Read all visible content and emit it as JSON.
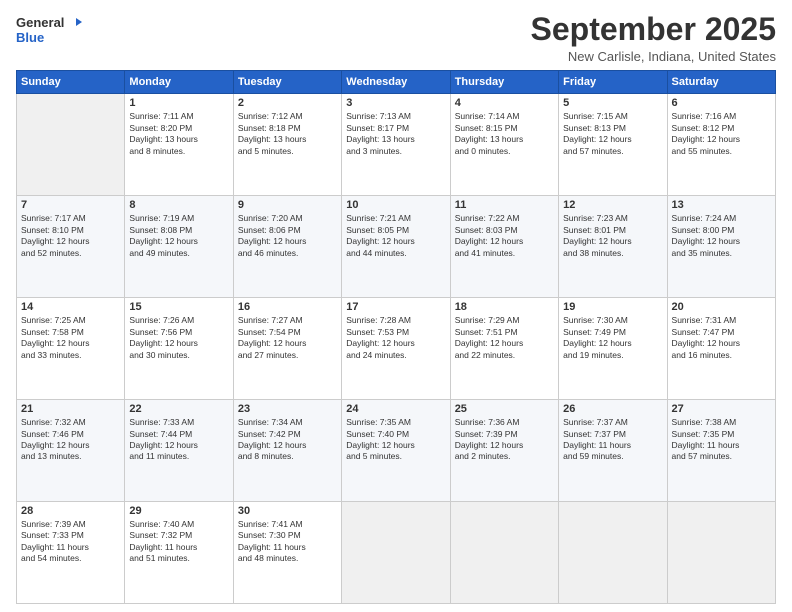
{
  "logo": {
    "line1": "General",
    "line2": "Blue"
  },
  "title": "September 2025",
  "subtitle": "New Carlisle, Indiana, United States",
  "days_of_week": [
    "Sunday",
    "Monday",
    "Tuesday",
    "Wednesday",
    "Thursday",
    "Friday",
    "Saturday"
  ],
  "weeks": [
    [
      {
        "day": "",
        "sunrise": "",
        "sunset": "",
        "daylight": ""
      },
      {
        "day": "1",
        "sunrise": "Sunrise: 7:11 AM",
        "sunset": "Sunset: 8:20 PM",
        "daylight": "Daylight: 13 hours and 8 minutes."
      },
      {
        "day": "2",
        "sunrise": "Sunrise: 7:12 AM",
        "sunset": "Sunset: 8:18 PM",
        "daylight": "Daylight: 13 hours and 5 minutes."
      },
      {
        "day": "3",
        "sunrise": "Sunrise: 7:13 AM",
        "sunset": "Sunset: 8:17 PM",
        "daylight": "Daylight: 13 hours and 3 minutes."
      },
      {
        "day": "4",
        "sunrise": "Sunrise: 7:14 AM",
        "sunset": "Sunset: 8:15 PM",
        "daylight": "Daylight: 13 hours and 0 minutes."
      },
      {
        "day": "5",
        "sunrise": "Sunrise: 7:15 AM",
        "sunset": "Sunset: 8:13 PM",
        "daylight": "Daylight: 12 hours and 57 minutes."
      },
      {
        "day": "6",
        "sunrise": "Sunrise: 7:16 AM",
        "sunset": "Sunset: 8:12 PM",
        "daylight": "Daylight: 12 hours and 55 minutes."
      }
    ],
    [
      {
        "day": "7",
        "sunrise": "Sunrise: 7:17 AM",
        "sunset": "Sunset: 8:10 PM",
        "daylight": "Daylight: 12 hours and 52 minutes."
      },
      {
        "day": "8",
        "sunrise": "Sunrise: 7:19 AM",
        "sunset": "Sunset: 8:08 PM",
        "daylight": "Daylight: 12 hours and 49 minutes."
      },
      {
        "day": "9",
        "sunrise": "Sunrise: 7:20 AM",
        "sunset": "Sunset: 8:06 PM",
        "daylight": "Daylight: 12 hours and 46 minutes."
      },
      {
        "day": "10",
        "sunrise": "Sunrise: 7:21 AM",
        "sunset": "Sunset: 8:05 PM",
        "daylight": "Daylight: 12 hours and 44 minutes."
      },
      {
        "day": "11",
        "sunrise": "Sunrise: 7:22 AM",
        "sunset": "Sunset: 8:03 PM",
        "daylight": "Daylight: 12 hours and 41 minutes."
      },
      {
        "day": "12",
        "sunrise": "Sunrise: 7:23 AM",
        "sunset": "Sunset: 8:01 PM",
        "daylight": "Daylight: 12 hours and 38 minutes."
      },
      {
        "day": "13",
        "sunrise": "Sunrise: 7:24 AM",
        "sunset": "Sunset: 8:00 PM",
        "daylight": "Daylight: 12 hours and 35 minutes."
      }
    ],
    [
      {
        "day": "14",
        "sunrise": "Sunrise: 7:25 AM",
        "sunset": "Sunset: 7:58 PM",
        "daylight": "Daylight: 12 hours and 33 minutes."
      },
      {
        "day": "15",
        "sunrise": "Sunrise: 7:26 AM",
        "sunset": "Sunset: 7:56 PM",
        "daylight": "Daylight: 12 hours and 30 minutes."
      },
      {
        "day": "16",
        "sunrise": "Sunrise: 7:27 AM",
        "sunset": "Sunset: 7:54 PM",
        "daylight": "Daylight: 12 hours and 27 minutes."
      },
      {
        "day": "17",
        "sunrise": "Sunrise: 7:28 AM",
        "sunset": "Sunset: 7:53 PM",
        "daylight": "Daylight: 12 hours and 24 minutes."
      },
      {
        "day": "18",
        "sunrise": "Sunrise: 7:29 AM",
        "sunset": "Sunset: 7:51 PM",
        "daylight": "Daylight: 12 hours and 22 minutes."
      },
      {
        "day": "19",
        "sunrise": "Sunrise: 7:30 AM",
        "sunset": "Sunset: 7:49 PM",
        "daylight": "Daylight: 12 hours and 19 minutes."
      },
      {
        "day": "20",
        "sunrise": "Sunrise: 7:31 AM",
        "sunset": "Sunset: 7:47 PM",
        "daylight": "Daylight: 12 hours and 16 minutes."
      }
    ],
    [
      {
        "day": "21",
        "sunrise": "Sunrise: 7:32 AM",
        "sunset": "Sunset: 7:46 PM",
        "daylight": "Daylight: 12 hours and 13 minutes."
      },
      {
        "day": "22",
        "sunrise": "Sunrise: 7:33 AM",
        "sunset": "Sunset: 7:44 PM",
        "daylight": "Daylight: 12 hours and 11 minutes."
      },
      {
        "day": "23",
        "sunrise": "Sunrise: 7:34 AM",
        "sunset": "Sunset: 7:42 PM",
        "daylight": "Daylight: 12 hours and 8 minutes."
      },
      {
        "day": "24",
        "sunrise": "Sunrise: 7:35 AM",
        "sunset": "Sunset: 7:40 PM",
        "daylight": "Daylight: 12 hours and 5 minutes."
      },
      {
        "day": "25",
        "sunrise": "Sunrise: 7:36 AM",
        "sunset": "Sunset: 7:39 PM",
        "daylight": "Daylight: 12 hours and 2 minutes."
      },
      {
        "day": "26",
        "sunrise": "Sunrise: 7:37 AM",
        "sunset": "Sunset: 7:37 PM",
        "daylight": "Daylight: 11 hours and 59 minutes."
      },
      {
        "day": "27",
        "sunrise": "Sunrise: 7:38 AM",
        "sunset": "Sunset: 7:35 PM",
        "daylight": "Daylight: 11 hours and 57 minutes."
      }
    ],
    [
      {
        "day": "28",
        "sunrise": "Sunrise: 7:39 AM",
        "sunset": "Sunset: 7:33 PM",
        "daylight": "Daylight: 11 hours and 54 minutes."
      },
      {
        "day": "29",
        "sunrise": "Sunrise: 7:40 AM",
        "sunset": "Sunset: 7:32 PM",
        "daylight": "Daylight: 11 hours and 51 minutes."
      },
      {
        "day": "30",
        "sunrise": "Sunrise: 7:41 AM",
        "sunset": "Sunset: 7:30 PM",
        "daylight": "Daylight: 11 hours and 48 minutes."
      },
      {
        "day": "",
        "sunrise": "",
        "sunset": "",
        "daylight": ""
      },
      {
        "day": "",
        "sunrise": "",
        "sunset": "",
        "daylight": ""
      },
      {
        "day": "",
        "sunrise": "",
        "sunset": "",
        "daylight": ""
      },
      {
        "day": "",
        "sunrise": "",
        "sunset": "",
        "daylight": ""
      }
    ]
  ]
}
